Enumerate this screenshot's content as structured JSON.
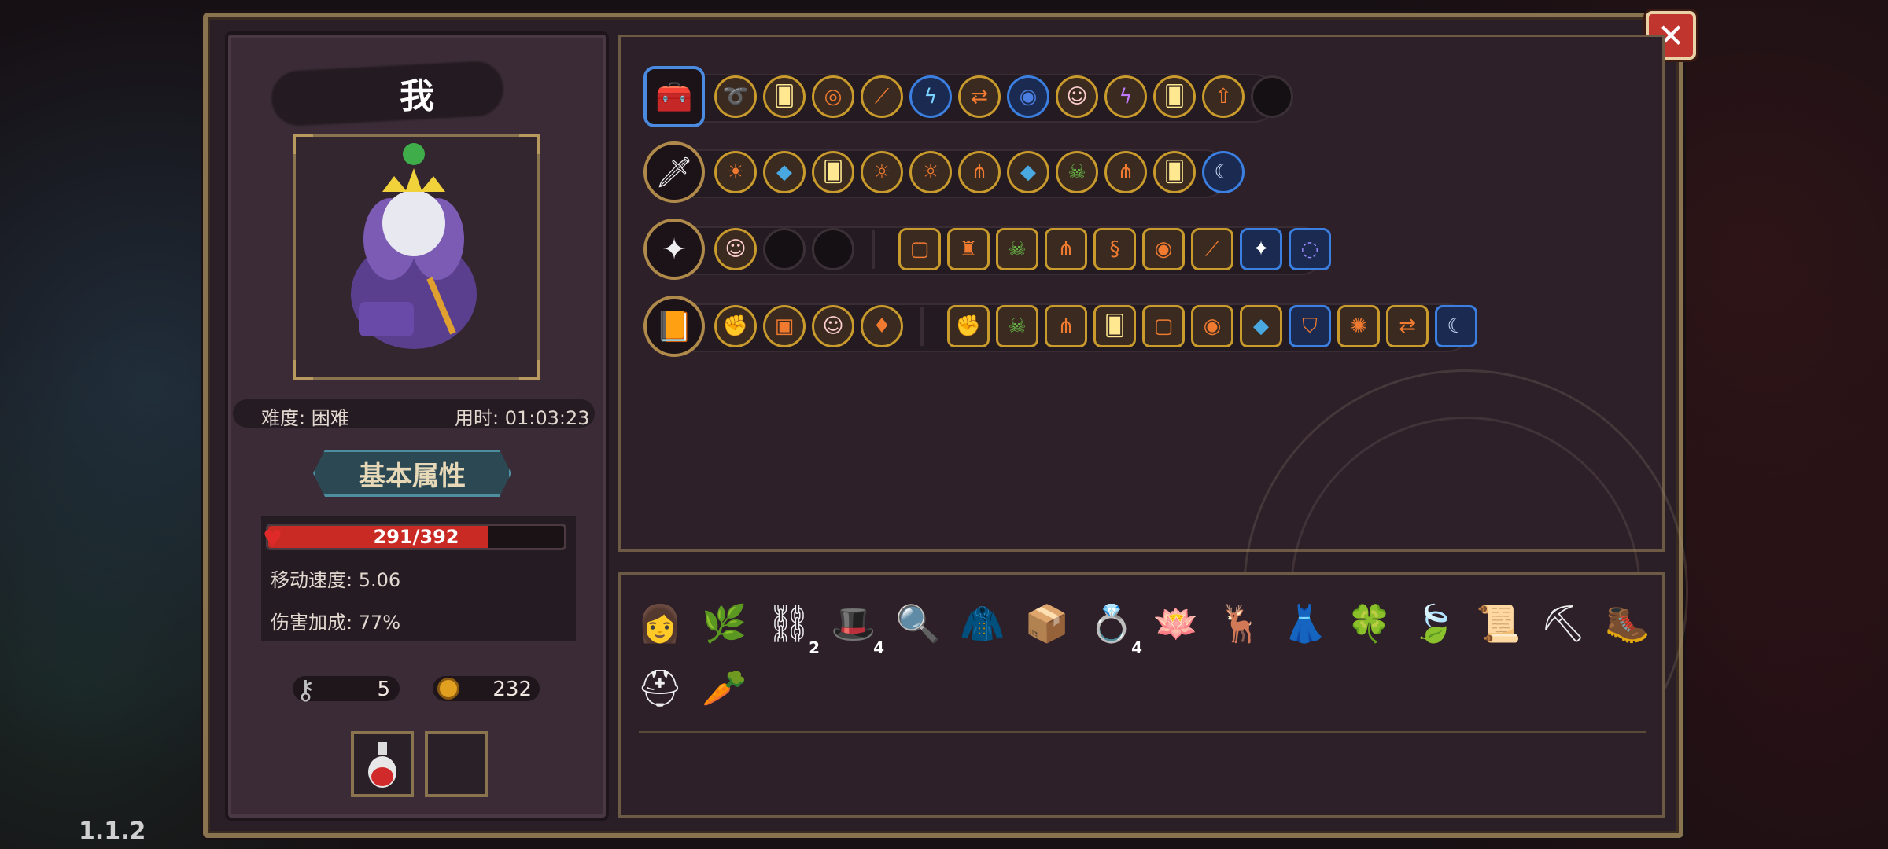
{
  "version": "1.1.2",
  "player": {
    "name": "我",
    "difficulty": "难度: 困难",
    "time": "用时: 01:03:23"
  },
  "attributes_tab": "基本属性",
  "stats": {
    "hp": "291/392",
    "hp_fraction": 0.743,
    "move_speed": "移动速度: 5.06",
    "damage_bonus": "伤害加成: 77%"
  },
  "resources": {
    "keys": "5",
    "coins": "232"
  },
  "close_glyph": "✕",
  "colors": {
    "gold_border": "#c99a2c",
    "blue_border": "#3b7fe0",
    "hp_red": "#c92a23",
    "tab_teal": "#2c4953"
  },
  "weapon_rows": [
    {
      "weapon_icon": "treasure-chest-icon",
      "weapon_glyph": "🧰",
      "slots": [
        "whip-icon",
        "card-icon",
        "target-icon",
        "claw-icon",
        "lightning-icon",
        "arrows-icon",
        "spiral-icon",
        "ghost-icon",
        "thunder-icon",
        "card-icon",
        "arrow-up-icon",
        "empty"
      ]
    },
    {
      "weapon_icon": "golden-staff-icon",
      "weapon_glyph": "🗡",
      "slots": [
        "sun-burst-icon",
        "crystal-icon",
        "card-icon",
        "sun-icon",
        "sun-icon",
        "triple-arrow-icon",
        "crystal-icon",
        "skull-icon",
        "triple-arrow-icon",
        "card-icon",
        "crescent-icon"
      ]
    },
    {
      "weapon_icon": "wand-icon",
      "weapon_glyph": "✦",
      "slots": [
        "ghost-icon",
        "empty",
        "empty"
      ],
      "extra": [
        "mouse-icon",
        "lantern-icon",
        "skull-icon",
        "triple-arrow-icon",
        "snake-icon",
        "eye-icon",
        "claw-icon",
        "sparkle-icon",
        "vortex-icon"
      ]
    },
    {
      "weapon_icon": "spellbook-icon",
      "weapon_glyph": "📙",
      "slots": [
        "fist-icon",
        "gauntlet-icon",
        "ghost-icon",
        "tie-icon"
      ],
      "extra": [
        "fist-icon",
        "skull-icon",
        "triple-arrow-icon",
        "card-icon",
        "mouse-icon",
        "eye-icon",
        "crystal-icon",
        "shield-icon",
        "burst-icon",
        "arrows-icon",
        "crescent-icon"
      ]
    }
  ],
  "inventory": [
    {
      "icon": "witch-portrait-icon",
      "glyph": "👩",
      "qty": ""
    },
    {
      "icon": "leaf-sprout-icon",
      "glyph": "🌿",
      "qty": ""
    },
    {
      "icon": "chain-icon",
      "glyph": "⛓",
      "qty": "2"
    },
    {
      "icon": "witch-hat-icon",
      "glyph": "🎩",
      "qty": "4"
    },
    {
      "icon": "magnifier-icon",
      "glyph": "🔍",
      "qty": ""
    },
    {
      "icon": "cloak-icon",
      "glyph": "🧥",
      "qty": ""
    },
    {
      "icon": "crate-icon",
      "glyph": "📦",
      "qty": ""
    },
    {
      "icon": "ring-icon",
      "glyph": "💍",
      "qty": "4"
    },
    {
      "icon": "lotus-icon",
      "glyph": "🪷",
      "qty": ""
    },
    {
      "icon": "antler-icon",
      "glyph": "🦌",
      "qty": ""
    },
    {
      "icon": "robe-icon",
      "glyph": "👗",
      "qty": ""
    },
    {
      "icon": "four-leaf-clover-icon",
      "glyph": "🍀",
      "qty": ""
    },
    {
      "icon": "leaf-icon",
      "glyph": "🍃",
      "qty": ""
    },
    {
      "icon": "scroll-icon",
      "glyph": "📜",
      "qty": ""
    },
    {
      "icon": "pickaxe-icon",
      "glyph": "⛏",
      "qty": ""
    },
    {
      "icon": "boot-icon",
      "glyph": "🥾",
      "qty": ""
    },
    {
      "icon": "helmet-icon",
      "glyph": "⛑",
      "qty": ""
    },
    {
      "icon": "carrot-icon",
      "glyph": "🥕",
      "qty": ""
    }
  ],
  "potion_slots": [
    "potion-icon",
    "empty"
  ]
}
